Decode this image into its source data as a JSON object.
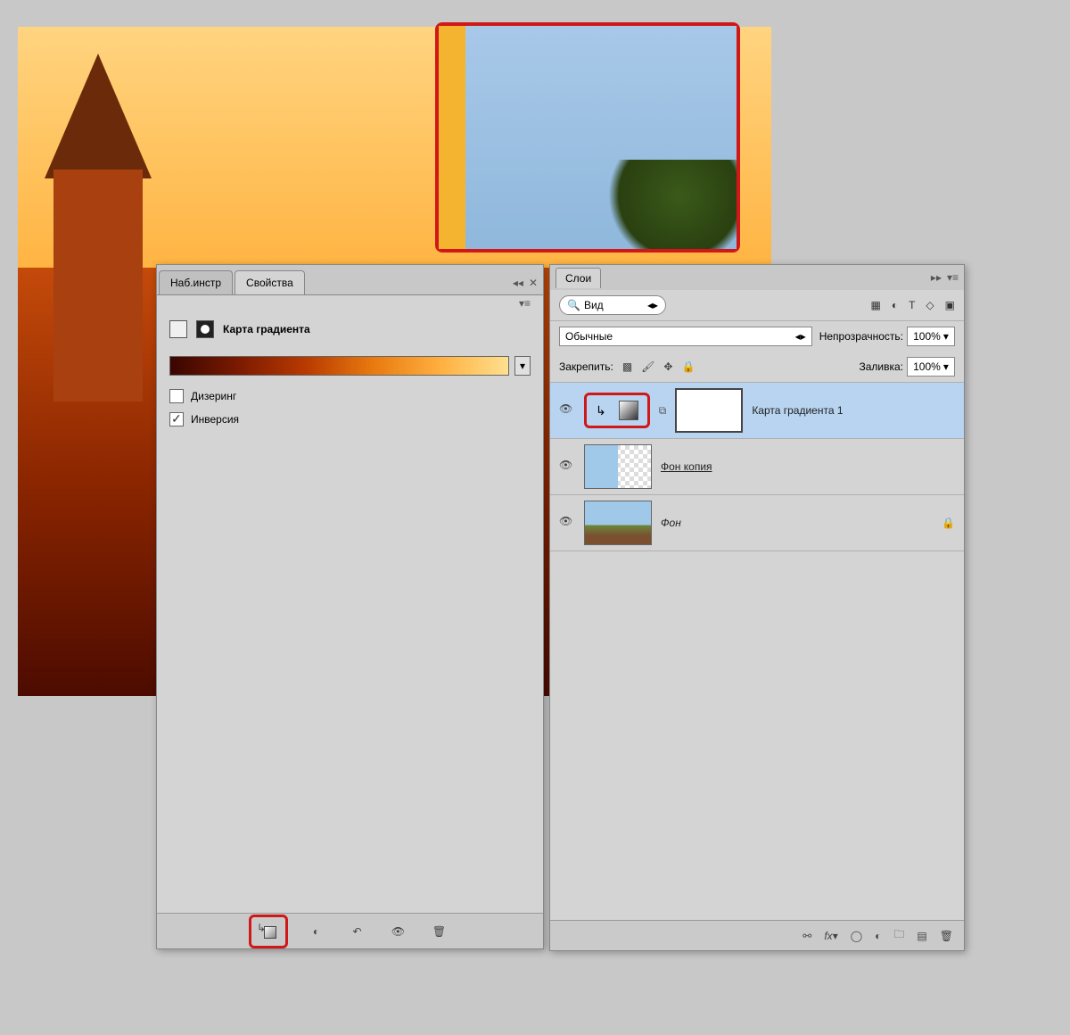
{
  "properties_panel": {
    "tabs": {
      "presets": "Наб.инстр",
      "properties": "Свойства"
    },
    "title": "Карта градиента",
    "dithering_label": "Дизеринг",
    "dithering_checked": false,
    "invert_label": "Инверсия",
    "invert_checked": true,
    "footer_icons": [
      "clip",
      "eye-adjust",
      "undo",
      "visibility",
      "trash"
    ]
  },
  "layers_panel": {
    "tab": "Слои",
    "filter_label": "Вид",
    "blend_mode": "Обычные",
    "opacity_label": "Непрозрачность:",
    "opacity_value": "100%",
    "lock_label": "Закрепить:",
    "fill_label": "Заливка:",
    "fill_value": "100%",
    "layers": [
      {
        "name": "Карта градиента 1",
        "type": "adjustment",
        "selected": true
      },
      {
        "name": "Фон копия ",
        "type": "photo-half",
        "underline": true
      },
      {
        "name": "Фон",
        "type": "photo",
        "locked": true
      }
    ],
    "footer_icons": [
      "link",
      "fx",
      "mask",
      "adjustment",
      "group",
      "new",
      "trash"
    ]
  },
  "colors": {
    "highlight_red": "#d01818",
    "panel_bg": "#d4d4d4"
  }
}
